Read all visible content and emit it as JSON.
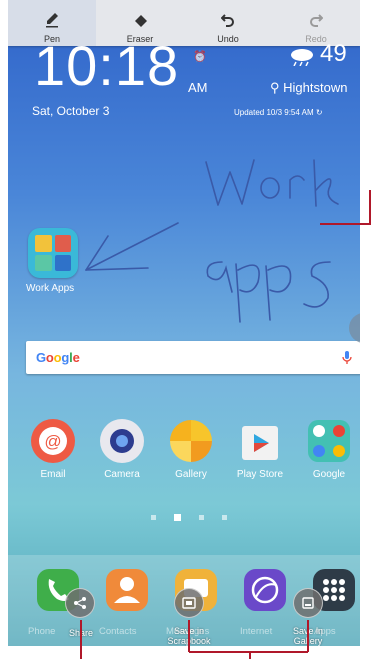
{
  "toolbar": {
    "items": [
      {
        "label": "Pen",
        "icon": "pen-icon",
        "active": true
      },
      {
        "label": "Eraser",
        "icon": "eraser-icon"
      },
      {
        "label": "Undo",
        "icon": "undo-icon"
      },
      {
        "label": "Redo",
        "icon": "redo-icon",
        "disabled": true
      }
    ]
  },
  "clock": {
    "time": "10:18",
    "ampm": "AM",
    "date": "Sat, October 3"
  },
  "weather": {
    "temp": "49",
    "location": "Hightstown",
    "updated": "Updated 10/3 9:54 AM"
  },
  "folder": {
    "label": "Work Apps"
  },
  "handwriting": {
    "text": "Work apps"
  },
  "search": {
    "logo": "Google"
  },
  "apps": [
    {
      "label": "Email",
      "icon": "email-icon"
    },
    {
      "label": "Camera",
      "icon": "camera-icon"
    },
    {
      "label": "Gallery",
      "icon": "gallery-icon"
    },
    {
      "label": "Play Store",
      "icon": "play-store-icon"
    },
    {
      "label": "Google",
      "icon": "google-folder-icon"
    }
  ],
  "dock": {
    "apps": [
      {
        "label": "Phone",
        "icon": "phone-icon"
      },
      {
        "label": "Contacts",
        "icon": "contacts-icon"
      },
      {
        "label": "Messages",
        "icon": "messages-icon"
      },
      {
        "label": "Internet",
        "icon": "internet-icon"
      },
      {
        "label": "Apps",
        "icon": "apps-grid-icon"
      }
    ]
  },
  "share_actions": [
    {
      "label": "Share",
      "icon": "share-icon"
    },
    {
      "label": "Save in Scrapbook",
      "icon": "scrapbook-icon"
    },
    {
      "label": "Save in Gallery",
      "icon": "save-gallery-icon"
    }
  ],
  "colors": {
    "callout": "#b0182a",
    "ink": "#3a5aa8"
  }
}
